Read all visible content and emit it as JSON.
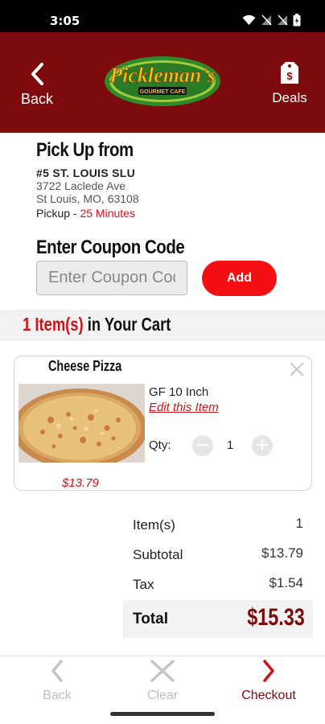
{
  "status_bar": {
    "time": "3:05"
  },
  "header": {
    "back_label": "Back",
    "deals_label": "Deals",
    "logo_text_main": "Pickleman's",
    "logo_text_sub": "GOURMET CAFE"
  },
  "pickup": {
    "title": "Pick Up from",
    "store_name": "#5 ST. LOUIS SLU",
    "address_line1": "3722 Laclede Ave",
    "address_line2": "St Louis, MO, 63108",
    "pickup_label": "Pickup - ",
    "pickup_time": "25 Minutes"
  },
  "coupon": {
    "title": "Enter Coupon Code",
    "placeholder": "Enter Coupon Code",
    "add_label": "Add"
  },
  "cart": {
    "count_text": "1 Item(s)",
    "title_rest": " in Your Cart",
    "items": [
      {
        "name": "Cheese Pizza",
        "size": "GF 10 Inch",
        "edit_label": "Edit this Item",
        "qty_label": "Qty:",
        "qty": "1",
        "price": "$13.79"
      }
    ]
  },
  "summary": {
    "items_label": "Item(s)",
    "items_value": "1",
    "subtotal_label": "Subtotal",
    "subtotal_value": "$13.79",
    "tax_label": "Tax",
    "tax_value": "$1.54",
    "total_label": "Total",
    "total_value": "$15.33"
  },
  "bottom_nav": {
    "back": "Back",
    "clear": "Clear",
    "checkout": "Checkout"
  },
  "colors": {
    "brand": "#7d0a0d",
    "accent": "#f30f12",
    "price": "#d0121a"
  }
}
